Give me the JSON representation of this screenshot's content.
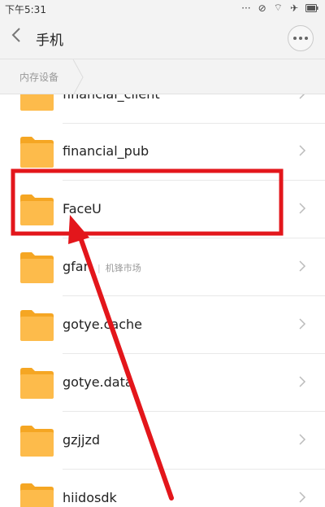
{
  "status_bar": {
    "time": "下午5:31",
    "icons": [
      "dots-icon",
      "alarm-icon",
      "wifi-icon",
      "airplane-icon",
      "battery-icon"
    ]
  },
  "header": {
    "title": "手机",
    "back_icon": "chevron-left-icon",
    "more_icon": "more-icon"
  },
  "breadcrumb": {
    "label": "内存设备"
  },
  "files": [
    {
      "name": "financial_client",
      "tag": ""
    },
    {
      "name": "financial_pub",
      "tag": ""
    },
    {
      "name": "FaceU",
      "tag": ""
    },
    {
      "name": "gfan",
      "tag": "机锋市场"
    },
    {
      "name": "gotye.cache",
      "tag": ""
    },
    {
      "name": "gotye.data",
      "tag": ""
    },
    {
      "name": "gzjjzd",
      "tag": ""
    },
    {
      "name": "hiidosdk",
      "tag": ""
    }
  ],
  "colors": {
    "folder": "#FDBB4B",
    "folder_tab": "#F5A623",
    "annotation": "#E3161B"
  }
}
